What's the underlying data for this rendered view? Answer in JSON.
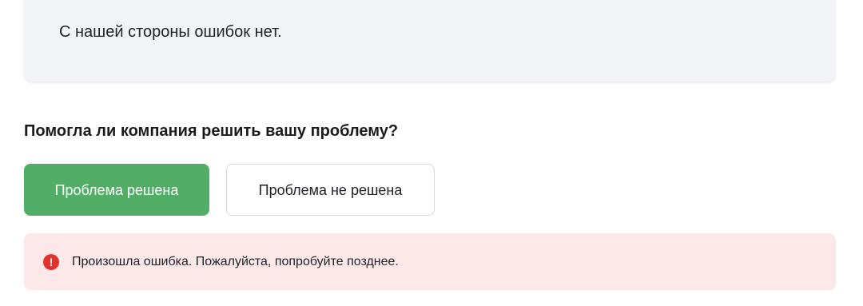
{
  "response": {
    "text": "С нашей стороны ошибок нет."
  },
  "feedback": {
    "question": "Помогла ли компания решить вашу проблему?",
    "solved_label": "Проблема решена",
    "unsolved_label": "Проблема не решена"
  },
  "error": {
    "icon": "exclamation-circle-icon",
    "icon_glyph": "!",
    "message": "Произошла ошибка. Пожалуйста, попробуйте позднее."
  },
  "colors": {
    "accent_green": "#52ad66",
    "error_red": "#e0332d",
    "error_background": "#fce8e8",
    "card_background": "#f3f4f8"
  }
}
